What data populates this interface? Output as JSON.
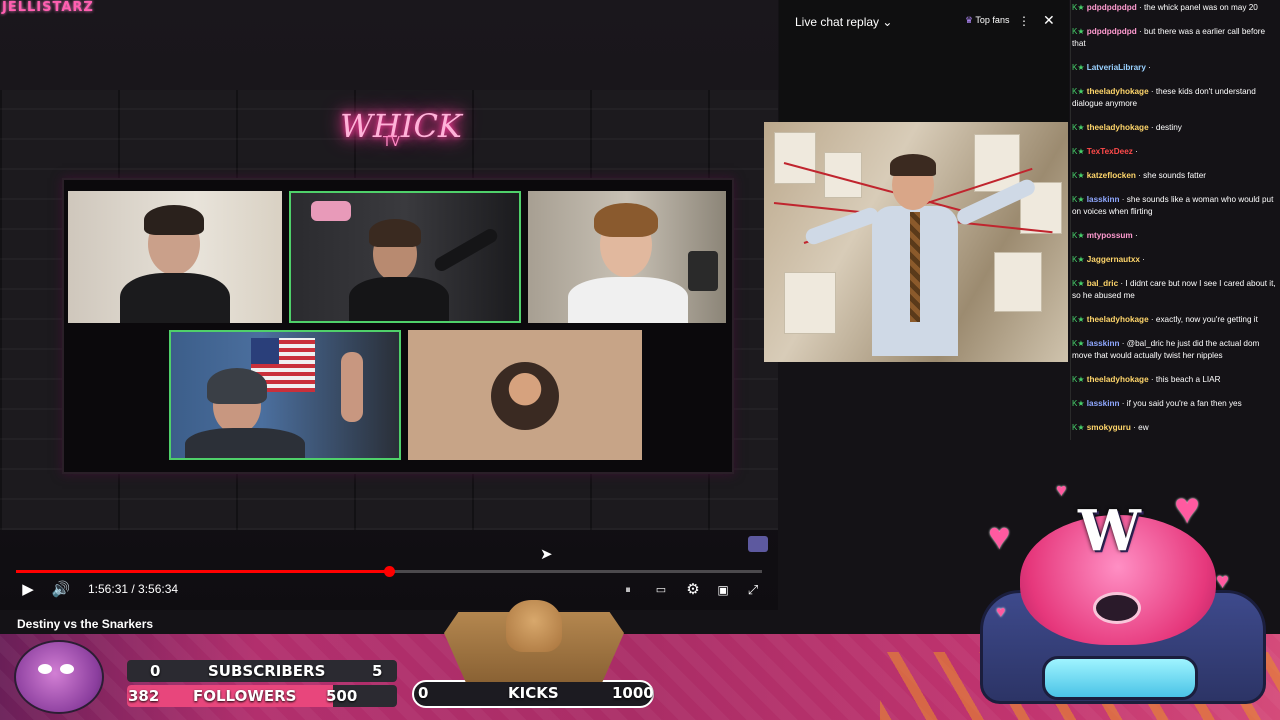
{
  "brand": {
    "text": "JELLISTARZ"
  },
  "stream": {
    "neon_sign": "WHICK",
    "neon_sub": "TV"
  },
  "player": {
    "progress": 0.5,
    "current_time": "1:56:31",
    "duration": "3:56:34",
    "time_display": "1:56:31 / 3:56:34",
    "title": "Destiny vs the Snarkers",
    "icons": {
      "play": "play-icon",
      "volume": "volume-icon",
      "pause_indicator": "autoplay-icon",
      "captions": "captions-icon",
      "settings": "settings-icon",
      "miniplayer": "miniplayer-icon",
      "fullscreen": "fullscreen-icon"
    }
  },
  "chat": {
    "header_title": "Live chat replay",
    "top_fans": "Top fans",
    "messages": [
      {
        "user": "pdpdpdpdpd",
        "text": "the whick panel was on may 20",
        "user_color": "#ff9bd0"
      },
      {
        "user": "pdpdpdpdpd",
        "text": "but there was a earlier call before that",
        "user_color": "#ff9bd0"
      },
      {
        "user": "LatveriaLibrary",
        "text": "",
        "user_color": "#9ad1ff"
      },
      {
        "user": "theeladyhokage",
        "text": "these kids don't understand dialogue anymore",
        "user_color": "#ffd66b"
      },
      {
        "user": "theeladyhokage",
        "text": "destiny",
        "user_color": "#ffd66b"
      },
      {
        "user": "TexTexDeez",
        "text": "",
        "user_color": "#ff4a4a"
      },
      {
        "user": "katzeflocken",
        "text": "she sounds fatter",
        "user_color": "#ffd66b"
      },
      {
        "user": "lasskinn",
        "text": "she sounds like a woman who would put on voices when flirting",
        "user_color": "#8fa8ff"
      },
      {
        "user": "mtypossum",
        "text": "",
        "user_color": "#ff9bd0"
      },
      {
        "user": "Jaggernautxx",
        "text": "",
        "user_color": "#ffd66b"
      },
      {
        "user": "bal_dric",
        "text": "I didnt care but now I see I cared about it, so he abused me",
        "user_color": "#ffd66b"
      },
      {
        "user": "theeladyhokage",
        "text": "exactly, now you're getting it",
        "user_color": "#ffd66b"
      },
      {
        "user": "lasskinn",
        "text": "@bal_dric he just did the actual dom move that would actually twist her nipples",
        "user_color": "#8fa8ff"
      },
      {
        "user": "theeladyhokage",
        "text": "this beach a LIAR",
        "user_color": "#ffd66b"
      },
      {
        "user": "lasskinn",
        "text": "if you said you're a fan then yes",
        "user_color": "#8fa8ff"
      },
      {
        "user": "smokyguru",
        "text": "ew",
        "user_color": "#ffd66b"
      }
    ]
  },
  "stats": {
    "subscribers": {
      "current": "0",
      "label": "SUBSCRIBERS",
      "goal": "5"
    },
    "followers": {
      "current": "382",
      "label": "FOLLOWERS",
      "goal": "500",
      "progress": 0.764
    },
    "kicks": {
      "current": "0",
      "label": "KICKS",
      "goal": "1000"
    }
  },
  "overlay": {
    "mascot_letter": "W"
  },
  "colors": {
    "progress": "#ff0000",
    "active_cam_border": "#4fd06a",
    "bottom_bar": "#b22f6d",
    "followers_fill": "#e8467c"
  }
}
